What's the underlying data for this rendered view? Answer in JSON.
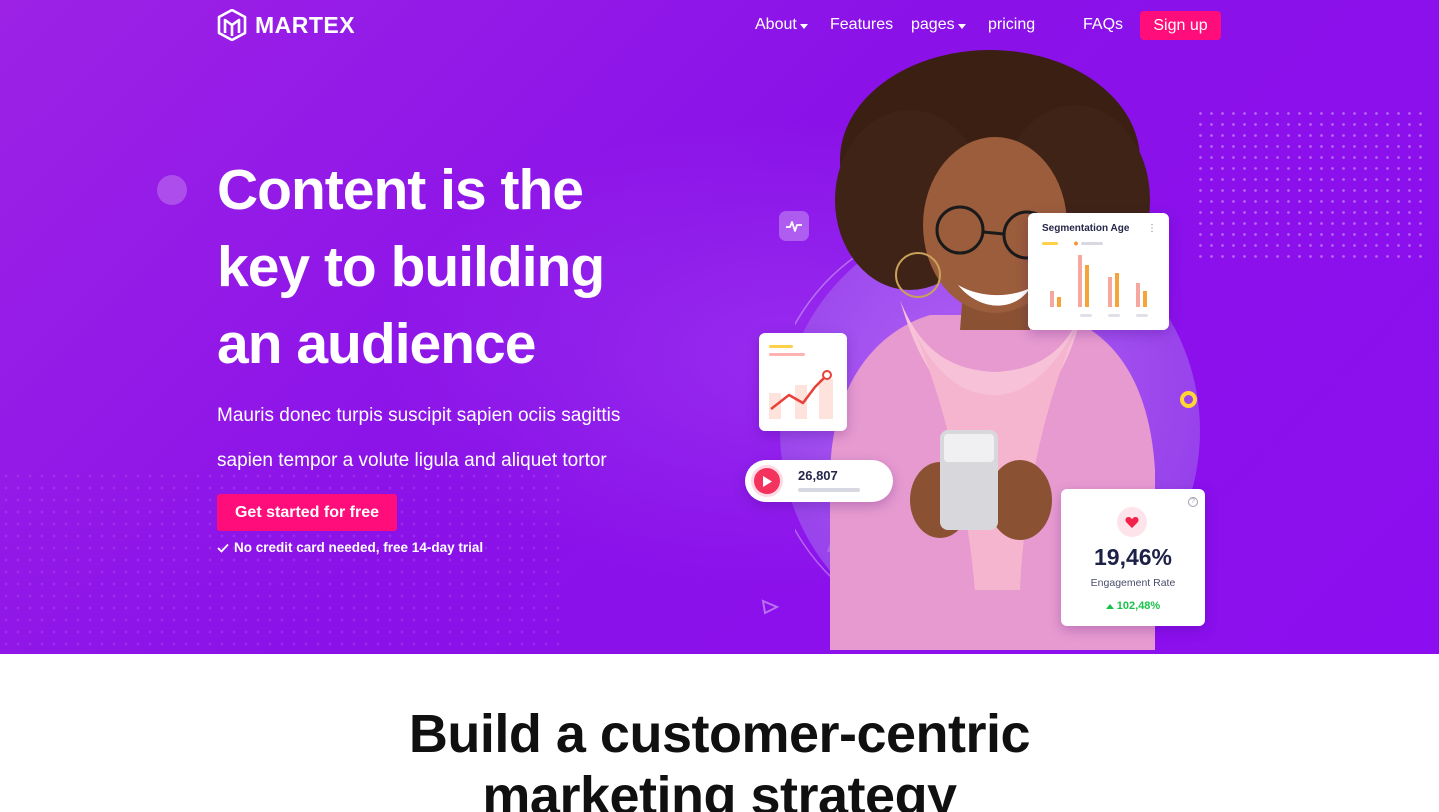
{
  "brand": {
    "name": "MARTEX"
  },
  "nav": {
    "items": [
      {
        "label": "About",
        "has_dropdown": true
      },
      {
        "label": "Features",
        "has_dropdown": false
      },
      {
        "label": "pages",
        "has_dropdown": true
      },
      {
        "label": "pricing",
        "has_dropdown": false
      },
      {
        "label": "FAQs",
        "has_dropdown": false
      }
    ],
    "signup_label": "Sign up"
  },
  "hero": {
    "headline_lines": [
      "Content is the",
      "key to building",
      "an audience"
    ],
    "subtext_lines": [
      "Mauris donec turpis suscipit sapien ociis sagittis",
      "sapien tempor a volute ligula and aliquet tortor"
    ],
    "cta_label": "Get started for free",
    "note": "No credit card needed, free 14-day trial"
  },
  "widgets": {
    "segmentation_title": "Segmentation Age",
    "play_count": "26,807",
    "engagement_value": "19,46%",
    "engagement_label": "Engagement Rate",
    "engagement_change": "102,48%"
  },
  "section2": {
    "title_lines": [
      "Build a customer-centric",
      "marketing strategy"
    ]
  },
  "colors": {
    "hero_bg": "#8a12e8",
    "accent_pink": "#ff0d7a",
    "accent_yellow": "#ffd633",
    "positive_green": "#19c24a",
    "dark_text": "#1d2147"
  },
  "icons": [
    "logo-icon",
    "chevron-down-icon",
    "check-icon",
    "pulse-icon",
    "play-icon",
    "heart-icon",
    "help-icon",
    "more-vertical-icon",
    "arrow-up-icon"
  ]
}
